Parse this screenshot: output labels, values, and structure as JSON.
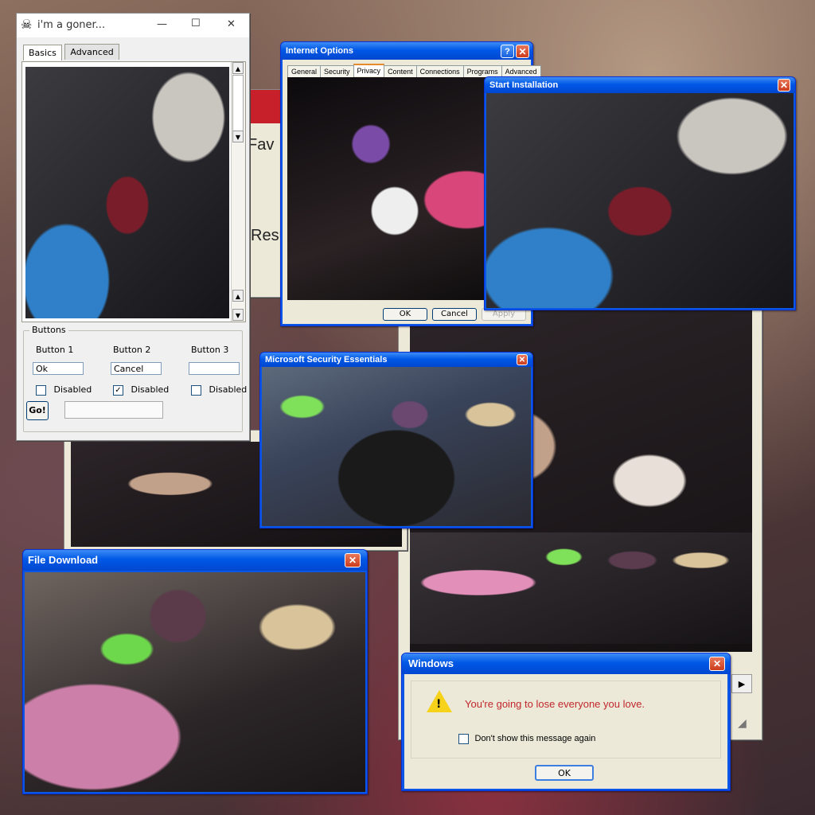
{
  "gonerWindow": {
    "title": "i'm a goner...",
    "minimize": "—",
    "maximize": "☐",
    "close": "✕",
    "tabs": [
      "Basics",
      "Advanced"
    ],
    "group": "Buttons",
    "columns": [
      {
        "label": "Button 1",
        "value": "Ok",
        "checked": false,
        "checkLabel": "Disabled"
      },
      {
        "label": "Button 2",
        "value": "Cancel",
        "checked": true,
        "checkLabel": "Disabled"
      },
      {
        "label": "Button 3",
        "value": "",
        "checked": false,
        "checkLabel": "Disabled"
      }
    ],
    "goLabel": "Go!"
  },
  "partialWindow": {
    "fav": "Fav",
    "res": "Resu"
  },
  "internetOptions": {
    "title": "Internet Options",
    "help": "?",
    "close": "✕",
    "tabs": [
      "General",
      "Security",
      "Privacy",
      "Content",
      "Connections",
      "Programs",
      "Advanced"
    ],
    "ok": "OK",
    "cancel": "Cancel",
    "apply": "Apply"
  },
  "startInstallation": {
    "title": "Start Installation",
    "close": "✕"
  },
  "securityEssentials": {
    "title": "Microsoft Security Essentials",
    "close": "✕"
  },
  "fileDownload": {
    "title": "File Download",
    "close": "✕"
  },
  "windowsDialog": {
    "title": "Windows",
    "close": "✕",
    "warning": "!",
    "message": "You're going to lose everyone you love.",
    "checkbox": "Don't show this message again",
    "ok": "OK",
    "messageColor": "#c1272d"
  }
}
